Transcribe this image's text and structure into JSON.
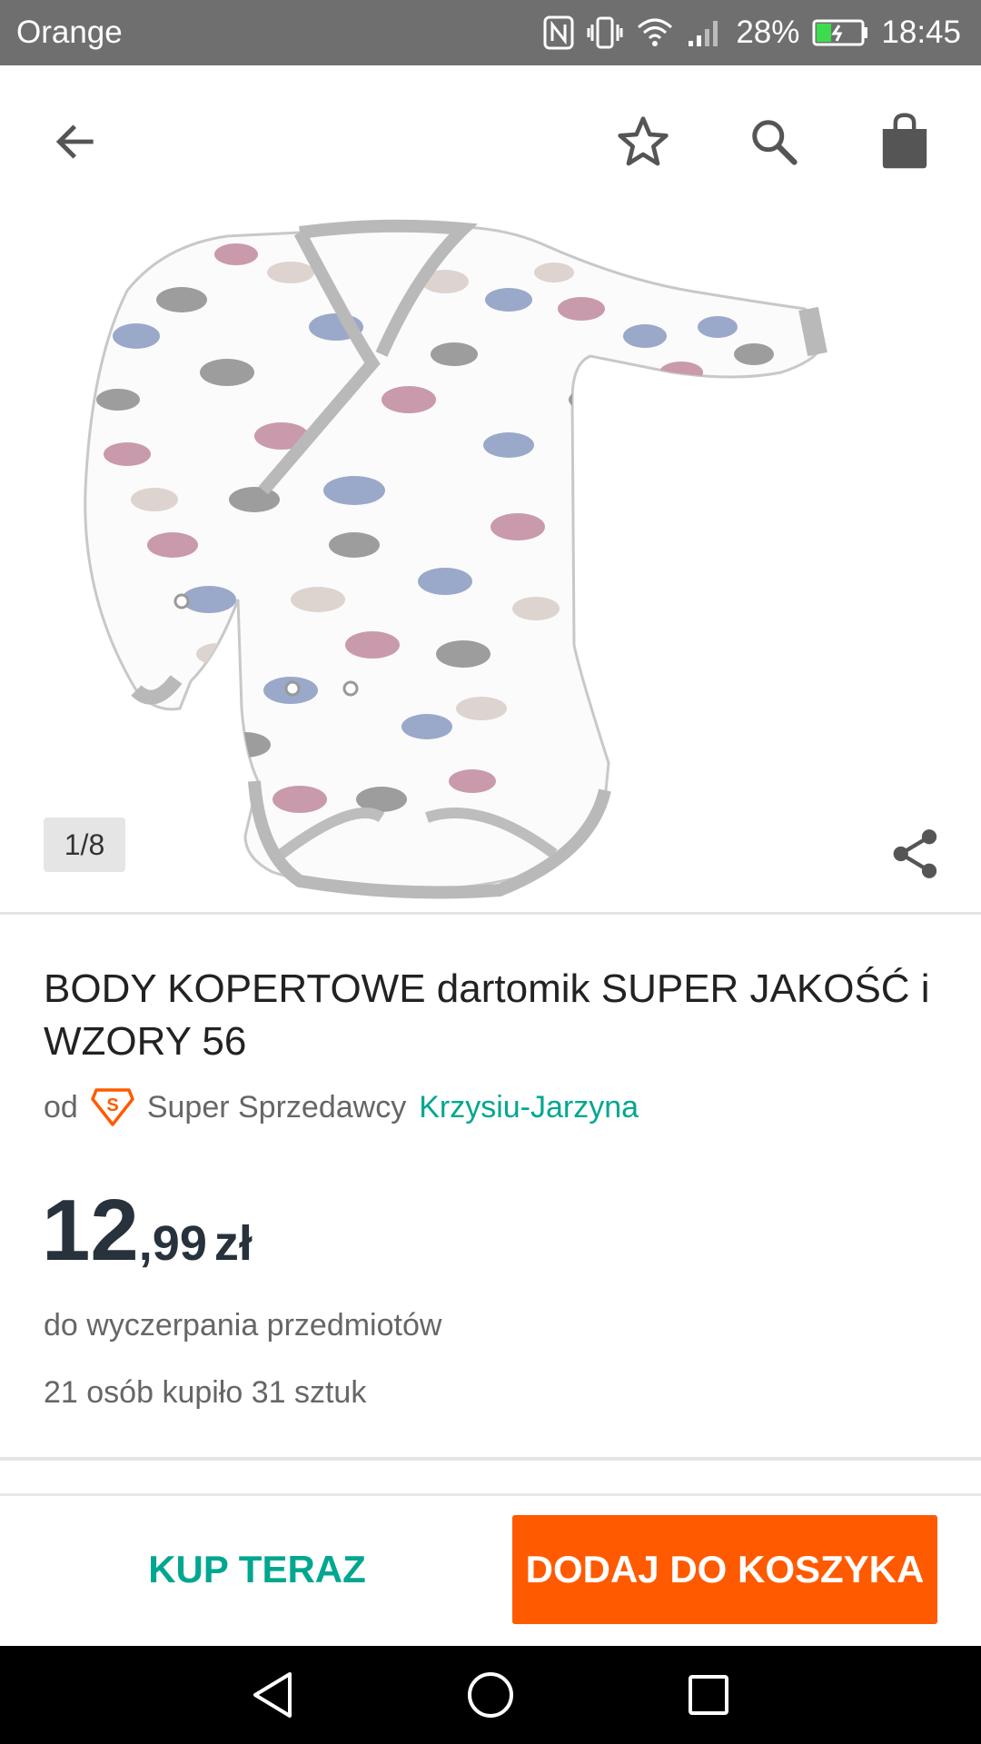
{
  "status_bar": {
    "carrier": "Orange",
    "battery": "28%",
    "time": "18:45",
    "icons": [
      "nfc-icon",
      "vibrate-icon",
      "wifi-icon",
      "signal-icon",
      "battery-icon"
    ]
  },
  "app_bar": {
    "icons": [
      "arrow-back-icon",
      "star-outline-icon",
      "search-icon",
      "shopping-bag-icon"
    ]
  },
  "gallery": {
    "counter": "1/8",
    "image_description_icon": "product-photo",
    "share_icon": "share-icon"
  },
  "product": {
    "title": "BODY KOPERTOWE dartomik SUPER JAKOŚĆ i WZORY 56",
    "seller_prefix": "od",
    "seller_type": "Super Sprzedawcy",
    "seller_name": "Krzysiu-Jarzyna",
    "price_main": "12",
    "price_cents": ",99",
    "price_currency": "zł",
    "availability": "do wyczerpania przedmiotów",
    "sold_info": "21 osób kupiło 31 sztuk"
  },
  "actions": {
    "buy_now": "KUP TERAZ",
    "add_to_cart": "DODAJ DO KOSZYKA"
  },
  "colors": {
    "accent_teal": "#00a790",
    "accent_orange": "#ff5a00",
    "status_bar": "#6f6f6f",
    "price_text": "#28323c"
  }
}
